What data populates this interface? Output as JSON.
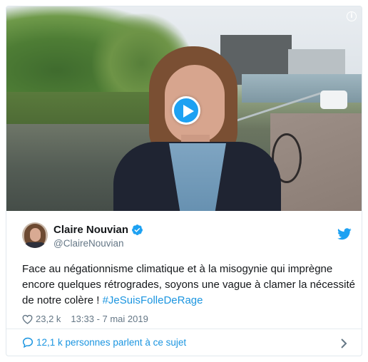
{
  "tweet": {
    "author": {
      "name": "Claire Nouvian",
      "handle": "@ClaireNouvian",
      "verified": true
    },
    "text_main": "Face au négationnisme climatique et à la misogynie qui imprègne encore quelques rétrogrades, soyons une vague à clamer la nécessité de notre colère !",
    "hashtag": "#JeSuisFolleDeRage",
    "likes": "23,2 k",
    "timestamp": "13:33 - 7 mai 2019",
    "conversation": "12,1 k personnes parlent à ce sujet"
  },
  "icons": {
    "info": "info-icon",
    "play": "play-icon",
    "verified": "verified-badge-icon",
    "bird": "twitter-bird-icon",
    "heart": "heart-icon",
    "comment": "comment-bubble-icon",
    "chevron": "chevron-right-icon"
  },
  "colors": {
    "accent": "#1da1f2",
    "link": "#1b95e0",
    "text": "#14171a",
    "muted": "#657786",
    "border": "#e1e8ed"
  },
  "info_glyph": "i"
}
